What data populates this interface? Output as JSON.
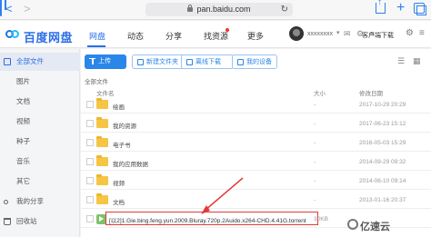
{
  "browser": {
    "url": "pan.baidu.com",
    "back_glyph": "<",
    "forward_glyph": ">",
    "plus_glyph": "+",
    "reload_glyph": "↻"
  },
  "header": {
    "brand": "百度网盘",
    "nav": [
      "网盘",
      "动态",
      "分享",
      "找资源",
      "更多"
    ],
    "active_nav": 0,
    "username": "xxxxxxxx",
    "client_label": "客户端下载",
    "caret": "▾",
    "icons_text": "✉ ⚙ ≡"
  },
  "sidebar": {
    "items": [
      {
        "label": "全部文件",
        "icon": "folder-icon",
        "active": true
      },
      {
        "label": "图片"
      },
      {
        "label": "文档"
      },
      {
        "label": "视频"
      },
      {
        "label": "种子"
      },
      {
        "label": "音乐"
      },
      {
        "label": "其它"
      },
      {
        "label": "我的分享",
        "icon": "share-icon"
      },
      {
        "label": "回收站",
        "icon": "trash-icon"
      }
    ]
  },
  "toolbar": {
    "upload": "上传",
    "new_folder": "新建文件夹",
    "offline_download": "离线下载",
    "my_devices": "我的设备"
  },
  "list": {
    "breadcrumb": "全部文件",
    "col_name": "文件名",
    "col_size": "大小",
    "col_date": "修改日期",
    "rows": [
      {
        "name": "绘画",
        "size": "-",
        "date": "2017-10-29 20:29",
        "type": "folder"
      },
      {
        "name": "我的资源",
        "size": "-",
        "date": "2017-06-23 15:12",
        "type": "folder"
      },
      {
        "name": "电子书",
        "size": "-",
        "date": "2016-05-03 15:29",
        "type": "folder"
      },
      {
        "name": "我的应用数据",
        "size": "-",
        "date": "2014-09-29 09:32",
        "type": "folder"
      },
      {
        "name": "视频",
        "size": "-",
        "date": "2014-06-10 09:14",
        "type": "folder"
      },
      {
        "name": "文档",
        "size": "-",
        "date": "2013-01-16 20:37",
        "type": "folder"
      },
      {
        "name": "[以2]1.Gie.bing.feng.yun.2009.Bluray.720p.2Auido.x264-CHD.4.41G.torrent",
        "size": "30KB",
        "date": "",
        "type": "torrent"
      }
    ]
  },
  "watermark": "亿速云",
  "colors": {
    "accent": "#2a6ee8",
    "highlight": "#e23a3a",
    "folder": "#f6c544"
  }
}
